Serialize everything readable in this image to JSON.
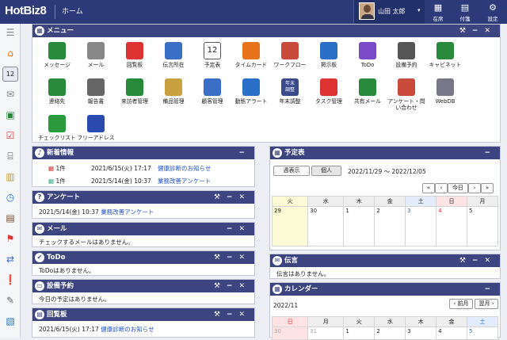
{
  "header": {
    "logo": "HotBiz8",
    "home": "ホーム",
    "user": "山田 太郎",
    "buttons": [
      {
        "label": "在席",
        "icon": "building-icon"
      },
      {
        "label": "付箋",
        "icon": "memo-icon"
      },
      {
        "label": "設定",
        "icon": "gear-icon"
      }
    ]
  },
  "menu": {
    "title": "メニュー",
    "items": [
      "メッセージ",
      "メール",
      "回覧板",
      "伝言所在",
      "予定表",
      "タイムカード",
      "ワークフロー",
      "掲示板",
      "ToDo",
      "設備予約",
      "キャビネット",
      "連絡先",
      "報告書",
      "来訪者管理",
      "備品管理",
      "顧客管理",
      "動態アラート",
      "年末調整",
      "タスク管理",
      "共有メール",
      "アンケート・問い合わせ",
      "WebDB",
      "チェックリスト",
      "フリーアドレス"
    ],
    "calendar_icon_num": "12",
    "nenmatsu_icon_text": "年末\n調整"
  },
  "news": {
    "title": "新着情報",
    "rows": [
      {
        "count": "1件",
        "date": "2021/6/15(火) 17:17",
        "link": "健康診断のお知らせ"
      },
      {
        "count": "1件",
        "date": "2021/5/14(金) 10:37",
        "link": "業務改善アンケート"
      }
    ]
  },
  "survey": {
    "title": "アンケート",
    "date": "2021/5/14(金) 10:37",
    "link": "業務改善アンケート"
  },
  "mail": {
    "title": "メール",
    "message": "チェックするメールはありません。"
  },
  "todo": {
    "title": "ToDo",
    "message": "ToDoはありません。"
  },
  "facility": {
    "title": "設備予約",
    "message": "今日の予定はありません。"
  },
  "circular": {
    "title": "回覧板",
    "date": "2021/6/15(火) 17:17",
    "link": "健康診断のお知らせ"
  },
  "schedule": {
    "title": "予定表",
    "btn_week": "週表示",
    "btn_personal": "個人",
    "range": "2022/11/29 ～ 2022/12/05",
    "nav_today": "今日",
    "nav_prev2": "«",
    "nav_prev": "‹",
    "nav_next": "›",
    "nav_next2": "»",
    "weekdays": [
      "火",
      "水",
      "木",
      "金",
      "土",
      "日",
      "月"
    ],
    "days": [
      "29",
      "30",
      "1",
      "2",
      "3",
      "4",
      "5"
    ]
  },
  "dengon": {
    "title": "伝言",
    "message": "伝言はありません。"
  },
  "calendar": {
    "title": "カレンダー",
    "month": "2022/11",
    "prev": "‹ 前月",
    "next": "翌月 ›",
    "weekdays": [
      "日",
      "月",
      "火",
      "水",
      "木",
      "金",
      "土"
    ],
    "days": [
      "30",
      "31",
      "1",
      "2",
      "3",
      "4",
      "5"
    ]
  },
  "colors": {
    "header": "#2c3a7a",
    "panel_header": "#3d4580",
    "link": "#2251c8",
    "today": "#fdfbd5"
  }
}
